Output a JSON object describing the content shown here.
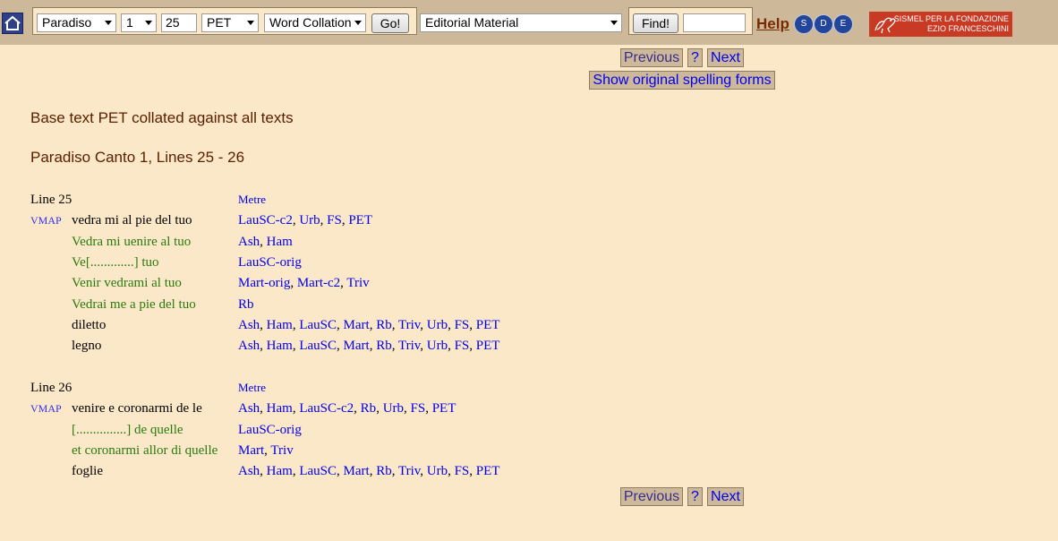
{
  "toolbar": {
    "book": "Paradiso",
    "canto": "1",
    "line": "25",
    "base_text": "PET",
    "view": "Word Collation",
    "go_label": "Go!",
    "material": "Editorial Material",
    "find_label": "Find!",
    "find_value": "",
    "help_label": "Help",
    "sde_letters": [
      "S",
      "D",
      "E"
    ],
    "logo_text": [
      "SISMEL PER LA FONDAZIONE",
      "EZIO FRANCESCHINI"
    ]
  },
  "nav": {
    "previous": "Previous",
    "question": "?",
    "next": "Next",
    "spelling": "Show original spelling forms"
  },
  "headings": {
    "collated": "Base text PET collated against all texts",
    "range": "Paradiso Canto 1, Lines 25 - 26"
  },
  "lines": [
    {
      "label": "Line 25",
      "metre": "Metre",
      "vmap": "VMAP",
      "readings": [
        {
          "text": "vedra mi al pie del tuo",
          "kind": "base",
          "witnesses": [
            "LauSC-c2",
            "Urb",
            "FS",
            "PET"
          ]
        },
        {
          "text": "Vedra mi uenire al tuo",
          "kind": "variant",
          "witnesses": [
            "Ash",
            "Ham"
          ]
        },
        {
          "text": "Ve[.............] tuo",
          "kind": "variant",
          "witnesses": [
            "LauSC-orig"
          ]
        },
        {
          "text": "Venir vedrami al tuo",
          "kind": "variant",
          "witnesses": [
            "Mart-orig",
            "Mart-c2",
            "Triv"
          ]
        },
        {
          "text": "Vedrai me a pie del tuo",
          "kind": "variant",
          "witnesses": [
            "Rb"
          ]
        },
        {
          "text": "diletto",
          "kind": "base",
          "witnesses": [
            "Ash",
            "Ham",
            "LauSC",
            "Mart",
            "Rb",
            "Triv",
            "Urb",
            "FS",
            "PET"
          ]
        },
        {
          "text": "legno",
          "kind": "base",
          "witnesses": [
            "Ash",
            "Ham",
            "LauSC",
            "Mart",
            "Rb",
            "Triv",
            "Urb",
            "FS",
            "PET"
          ]
        }
      ]
    },
    {
      "label": "Line 26",
      "metre": "Metre",
      "vmap": "VMAP",
      "readings": [
        {
          "text": "venire e coronarmi de le",
          "kind": "base",
          "witnesses": [
            "Ash",
            "Ham",
            "LauSC-c2",
            "Rb",
            "Urb",
            "FS",
            "PET"
          ]
        },
        {
          "text": "[...............] de quelle",
          "kind": "variant",
          "witnesses": [
            "LauSC-orig"
          ]
        },
        {
          "text": "et coronarmi allor di quelle",
          "kind": "variant",
          "witnesses": [
            "Mart",
            "Triv"
          ]
        },
        {
          "text": "foglie",
          "kind": "base",
          "witnesses": [
            "Ash",
            "Ham",
            "LauSC",
            "Mart",
            "Rb",
            "Triv",
            "Urb",
            "FS",
            "PET"
          ]
        }
      ]
    }
  ],
  "colors": {
    "background": "#fbe8c8",
    "toolbar": "#cdb99a",
    "base_reading": "#000000",
    "variant_reading": "#2a7a10",
    "witness_link": "#0000ee",
    "heading": "#5a2000"
  }
}
